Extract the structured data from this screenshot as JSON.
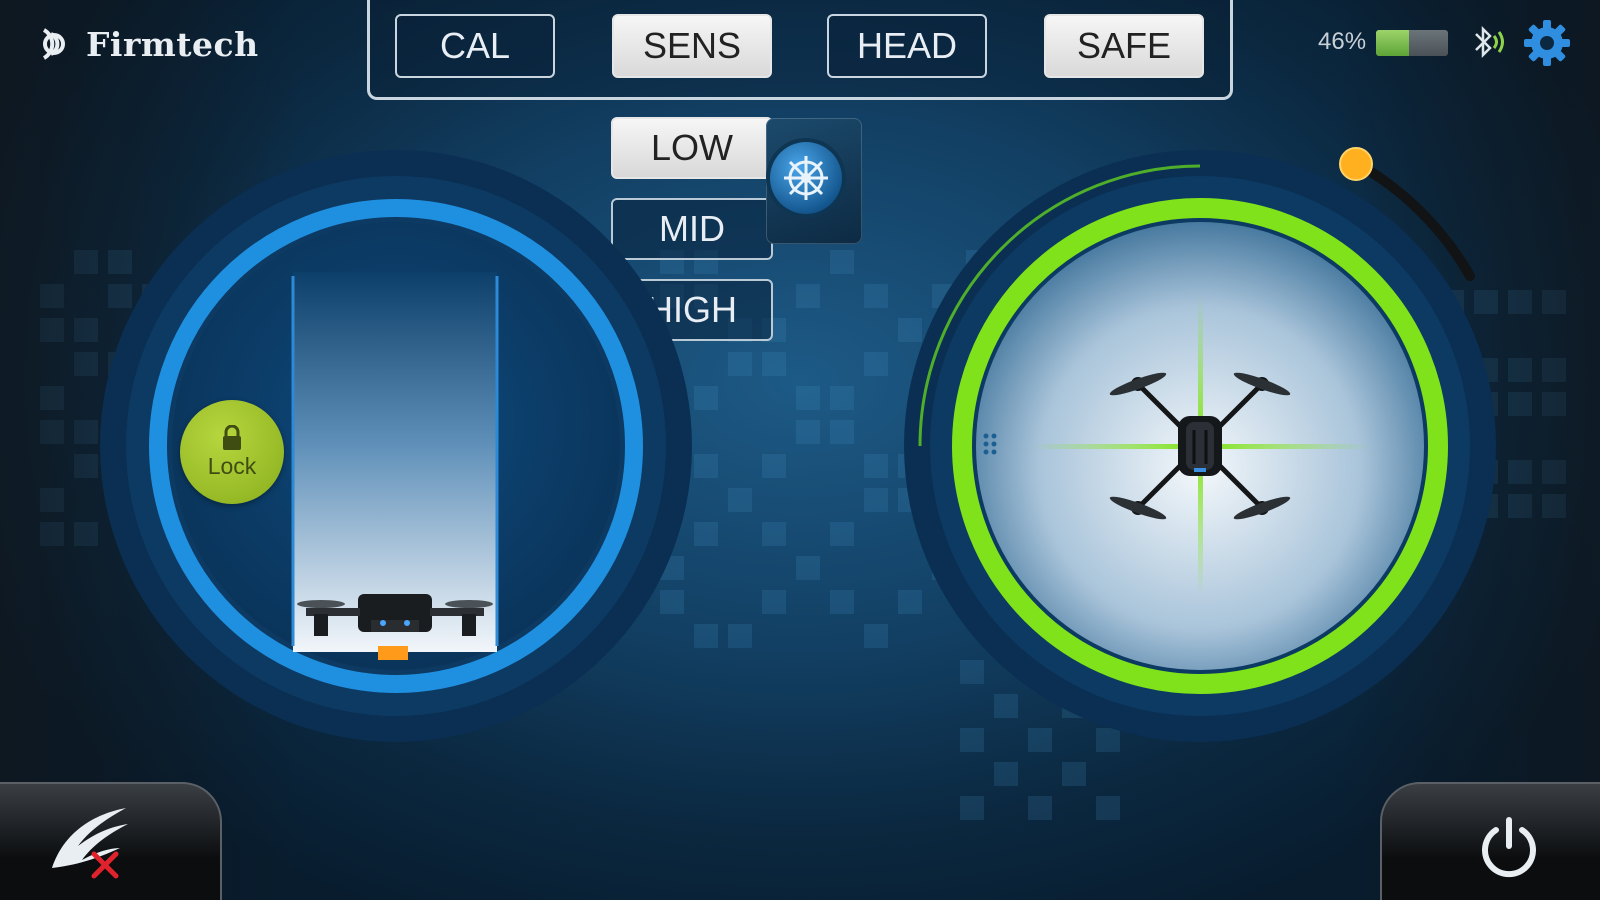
{
  "app": {
    "brand": "Firmtech"
  },
  "modes": [
    {
      "label": "CAL",
      "active": false
    },
    {
      "label": "SENS",
      "active": true
    },
    {
      "label": "HEAD",
      "active": false
    },
    {
      "label": "SAFE",
      "active": true
    }
  ],
  "sensitivity": {
    "options": [
      {
        "label": "LOW",
        "selected": true
      },
      {
        "label": "MID",
        "selected": false
      },
      {
        "label": "HIGH",
        "selected": false
      }
    ]
  },
  "status": {
    "battery_text": "46%",
    "battery_level": 0.46,
    "bluetooth": "connected"
  },
  "left_stick": {
    "lock_label": "Lock"
  },
  "icons": {
    "logo": "firmtech-logo-icon",
    "wheel": "helm-wheel-icon",
    "bluetooth": "bluetooth-icon",
    "settings": "gear-icon",
    "lock": "lock-icon",
    "disconnect": "wing-disconnect-icon",
    "power": "power-icon"
  },
  "colors": {
    "accent_blue": "#1f8fe0",
    "accent_green": "#7fe21a",
    "lock_green": "#a9cb2f",
    "throttle_orange": "#ff9a1a",
    "alert_red": "#e0222c"
  }
}
